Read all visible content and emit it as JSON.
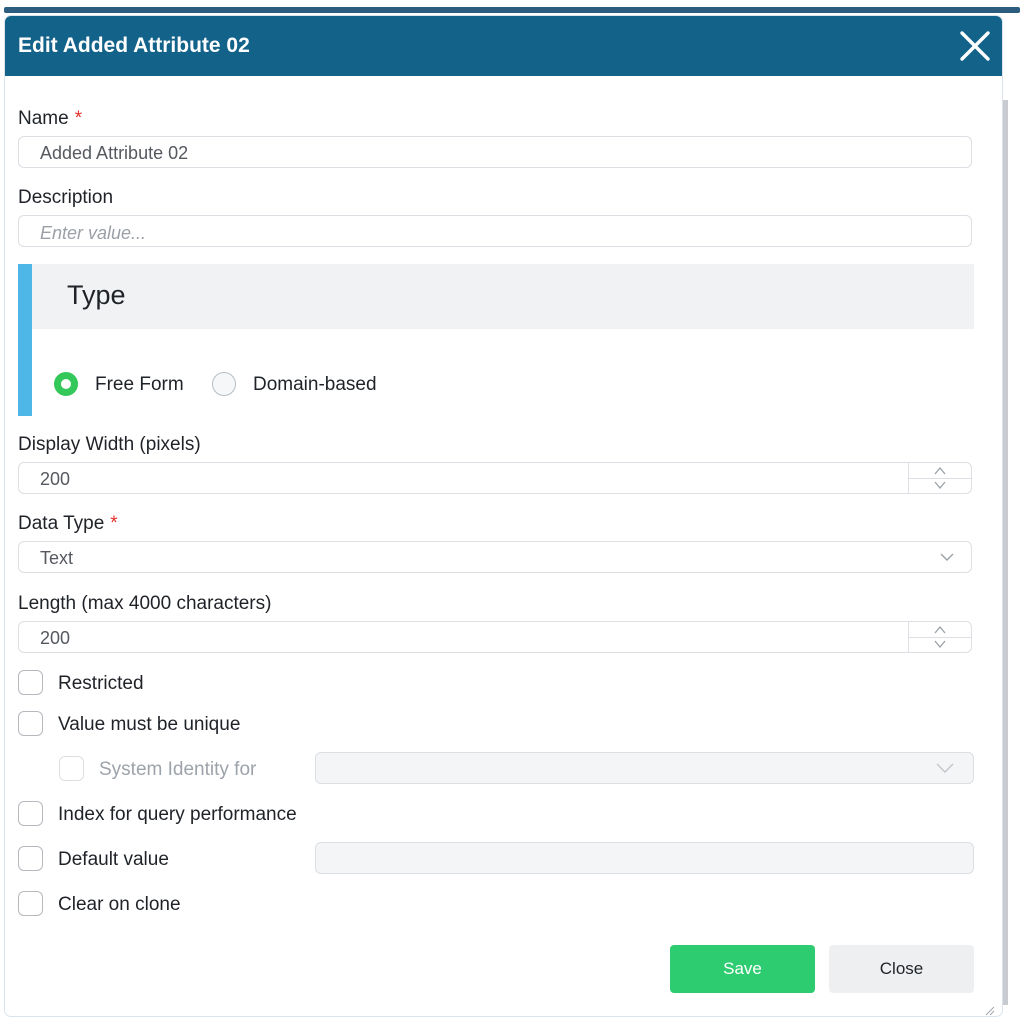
{
  "dialog": {
    "title": "Edit Added Attribute 02",
    "close_icon": "close-icon"
  },
  "name": {
    "label": "Name",
    "required_mark": "*",
    "value": "Added Attribute 02"
  },
  "description": {
    "label": "Description",
    "placeholder": "Enter value..."
  },
  "type_section": {
    "title": "Type",
    "options": [
      {
        "label": "Free Form",
        "selected": true
      },
      {
        "label": "Domain-based",
        "selected": false
      }
    ]
  },
  "display_width": {
    "label": "Display Width (pixels)",
    "value": "200"
  },
  "data_type": {
    "label": "Data Type",
    "required_mark": "*",
    "selected": "Text"
  },
  "length": {
    "label": "Length (max 4000 characters)",
    "value": "200"
  },
  "options": {
    "restricted": "Restricted",
    "unique": "Value must be unique",
    "system_identity": "System Identity for",
    "index": "Index for query performance",
    "default_value": "Default value",
    "clear_on_clone": "Clear on clone"
  },
  "buttons": {
    "save": "Save",
    "close": "Close"
  },
  "colors": {
    "header": "#13628a",
    "accent": "#4fb6e8",
    "save": "#2ecc71",
    "radio_selected": "#34c759",
    "required": "#e2322b"
  }
}
